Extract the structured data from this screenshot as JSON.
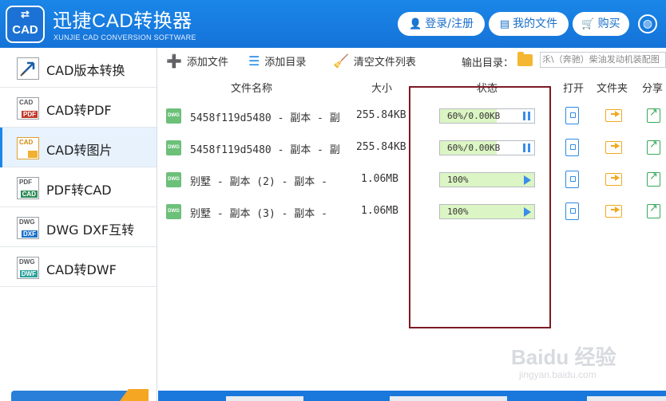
{
  "header": {
    "title": "迅捷CAD转换器",
    "subtitle": "XUNJIE CAD CONVERSION SOFTWARE",
    "logo_text": "CAD",
    "login_label": "登录/注册",
    "files_label": "我的文件",
    "buy_label": "购买"
  },
  "sidebar": {
    "items": [
      {
        "label": "CAD版本转换",
        "icon": "cad-version-icon",
        "icon_top": "",
        "icon_bottom": ""
      },
      {
        "label": "CAD转PDF",
        "icon": "cad-to-pdf-icon",
        "icon_top": "CAD",
        "icon_bottom": "PDF"
      },
      {
        "label": "CAD转图片",
        "icon": "cad-to-image-icon",
        "icon_top": "CAD",
        "icon_bottom": "",
        "active": true
      },
      {
        "label": "PDF转CAD",
        "icon": "pdf-to-cad-icon",
        "icon_top": "PDF",
        "icon_bottom": "CAD"
      },
      {
        "label": "DWG DXF互转",
        "icon": "dwg-dxf-icon",
        "icon_top": "DWG",
        "icon_bottom": "DXF"
      },
      {
        "label": "CAD转DWF",
        "icon": "cad-to-dwf-icon",
        "icon_top": "DWG",
        "icon_bottom": "DWF"
      }
    ]
  },
  "toolbar": {
    "add_file": "添加文件",
    "add_dir": "添加目录",
    "clear_list": "清空文件列表",
    "output_label": "输出目录：",
    "output_path": "乑\\（奔驰）柴油发动机装配图"
  },
  "table": {
    "headers": {
      "name": "文件名称",
      "size": "大小",
      "status": "状态",
      "open": "打开",
      "folder": "文件夹",
      "share": "分享"
    },
    "rows": [
      {
        "name": "5458f119d5480 - 副本 - 副",
        "size": "255.84KB",
        "status": "60%/0.00KB",
        "progress": 0.6,
        "action": "pause"
      },
      {
        "name": "5458f119d5480 - 副本 - 副",
        "size": "255.84KB",
        "status": "60%/0.00KB",
        "progress": 0.6,
        "action": "pause"
      },
      {
        "name": "别墅 - 副本 (2) - 副本 -",
        "size": "1.06MB",
        "status": "100%",
        "progress": 1.0,
        "action": "play"
      },
      {
        "name": "别墅 - 副本 (3) - 副本 -",
        "size": "1.06MB",
        "status": "100%",
        "progress": 1.0,
        "action": "play"
      }
    ]
  },
  "watermark": {
    "text": "Baidu 经验",
    "sub": "jingyan.baidu.com"
  },
  "colors": {
    "brand": "#1a86e8",
    "annotation": "#7b1a24",
    "progress": "#dcf5c4"
  }
}
